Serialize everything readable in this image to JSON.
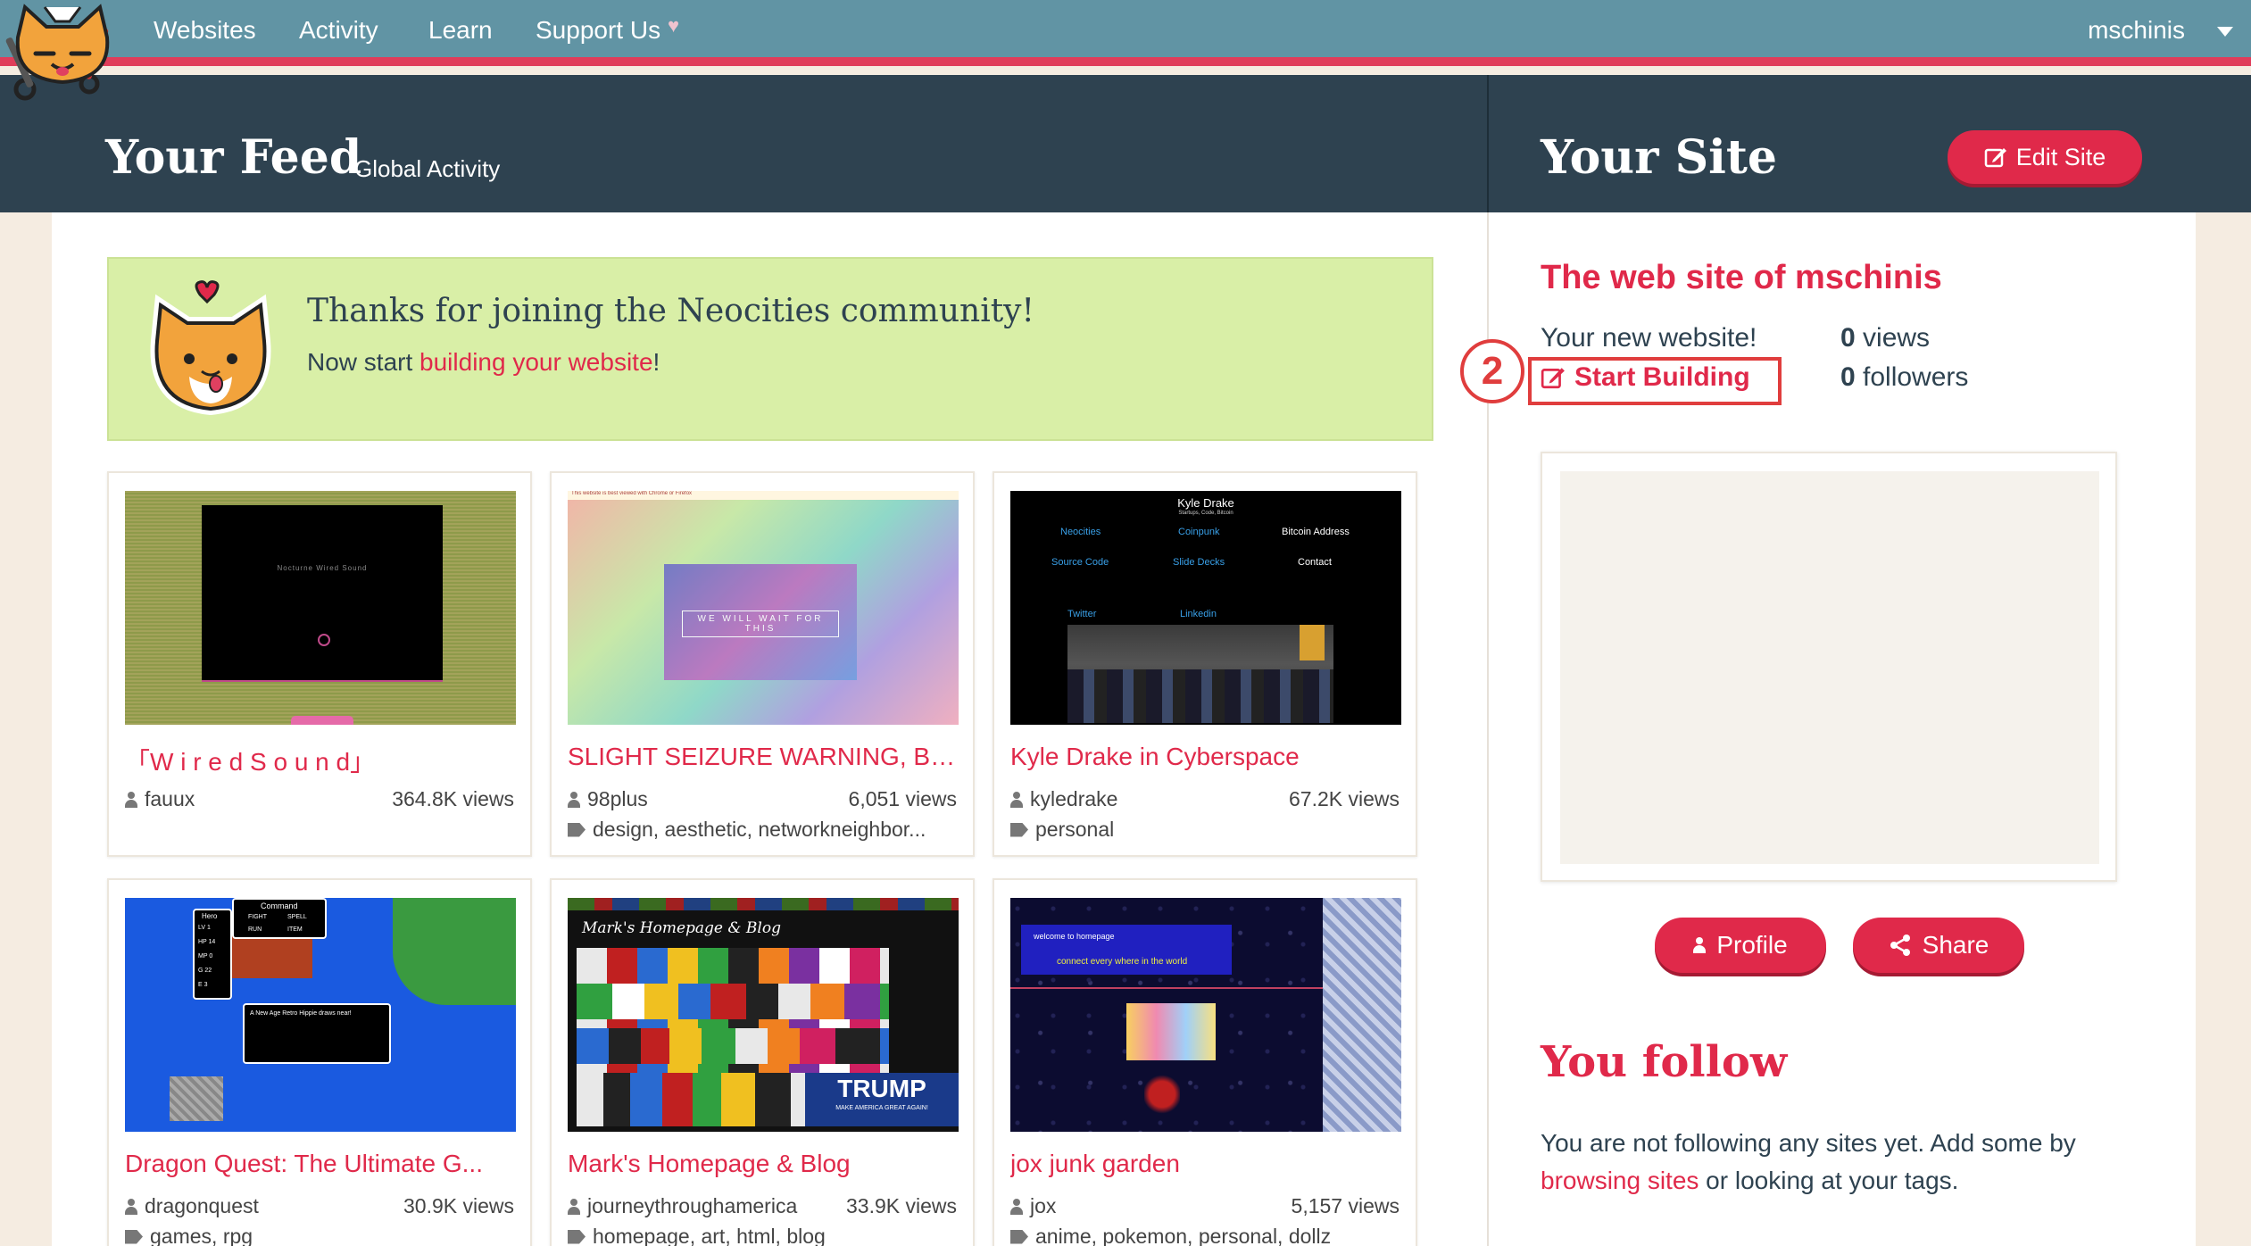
{
  "nav": {
    "links": [
      "Websites",
      "Activity",
      "Learn",
      "Support Us"
    ],
    "username": "mschinis"
  },
  "header": {
    "feed_title": "Your Feed",
    "global_activity": "Global Activity",
    "site_title": "Your Site",
    "edit_site": "Edit Site"
  },
  "welcome": {
    "title": "Thanks for joining the Neocities community!",
    "prefix": "Now start ",
    "link": "building your website",
    "suffix": "!"
  },
  "cards": [
    {
      "title": "「W i r e d   S o u n d」",
      "user": "fauux",
      "views": "364.8K views",
      "tags": ""
    },
    {
      "title": "SLIGHT SEIZURE WARNING, BE ...",
      "user": "98plus",
      "views": "6,051 views",
      "tags": "design, aesthetic, networkneighbor..."
    },
    {
      "title": "Kyle Drake in Cyberspace",
      "user": "kyledrake",
      "views": "67.2K views",
      "tags": "personal"
    },
    {
      "title": "Dragon Quest: The Ultimate G...",
      "user": "dragonquest",
      "views": "30.9K views",
      "tags": "games, rpg"
    },
    {
      "title": "Mark's Homepage & Blog",
      "user": "journeythroughamerica",
      "views": "33.9K views",
      "tags": "homepage, art, html, blog"
    },
    {
      "title": "jox junk garden",
      "user": "jox",
      "views": "5,157 views",
      "tags": "anime, pokemon, personal, dollz"
    }
  ],
  "thumbs": {
    "wired_text": "Nocturne Wired Sound",
    "slight_banner": "This website is best viewed with Chrome or Firefox",
    "slight_center": "WE WILL WAIT FOR THIS",
    "kyle_name": "Kyle Drake",
    "kyle_sub": "Startups, Code, Bitcoin",
    "kyle_links": [
      "Neocities",
      "Coinpunk",
      "Bitcoin Address",
      "Source Code",
      "Slide Decks",
      "Contact",
      "Twitter",
      "Linkedin"
    ],
    "dq_command": "Command",
    "dq_menu": [
      "FIGHT",
      "SPELL",
      "RUN",
      "ITEM"
    ],
    "dq_hero": "Hero",
    "dq_stats": [
      "LV 1",
      "HP 14",
      "MP 0",
      "G 22",
      "E 3"
    ],
    "dq_dialog": "A New Age Retro Hippie draws near!",
    "mark_title": "Mark's Homepage & Blog",
    "mark_trump": "TRUMP",
    "mark_trump_sub": "MAKE AMERICA GREAT AGAIN!",
    "jox_welcome": "welcome to homepage",
    "jox_connect": "connect every where in the world"
  },
  "site": {
    "name": "The web site of mschinis",
    "new_site": "Your new website!",
    "start_building": "Start Building",
    "views_count": "0",
    "views_label": " views",
    "followers_count": "0",
    "followers_label": " followers",
    "step_number": "2",
    "profile": "Profile",
    "share": "Share"
  },
  "follow": {
    "title": "You follow",
    "text_prefix": "You are not following any sites yet. Add some by ",
    "link": "browsing sites",
    "text_suffix": " or looking at your tags."
  },
  "colors": {
    "accent": "#e0294a",
    "nav": "#6194a4",
    "header": "#2e4250",
    "welcome_bg": "#d9efa7"
  }
}
